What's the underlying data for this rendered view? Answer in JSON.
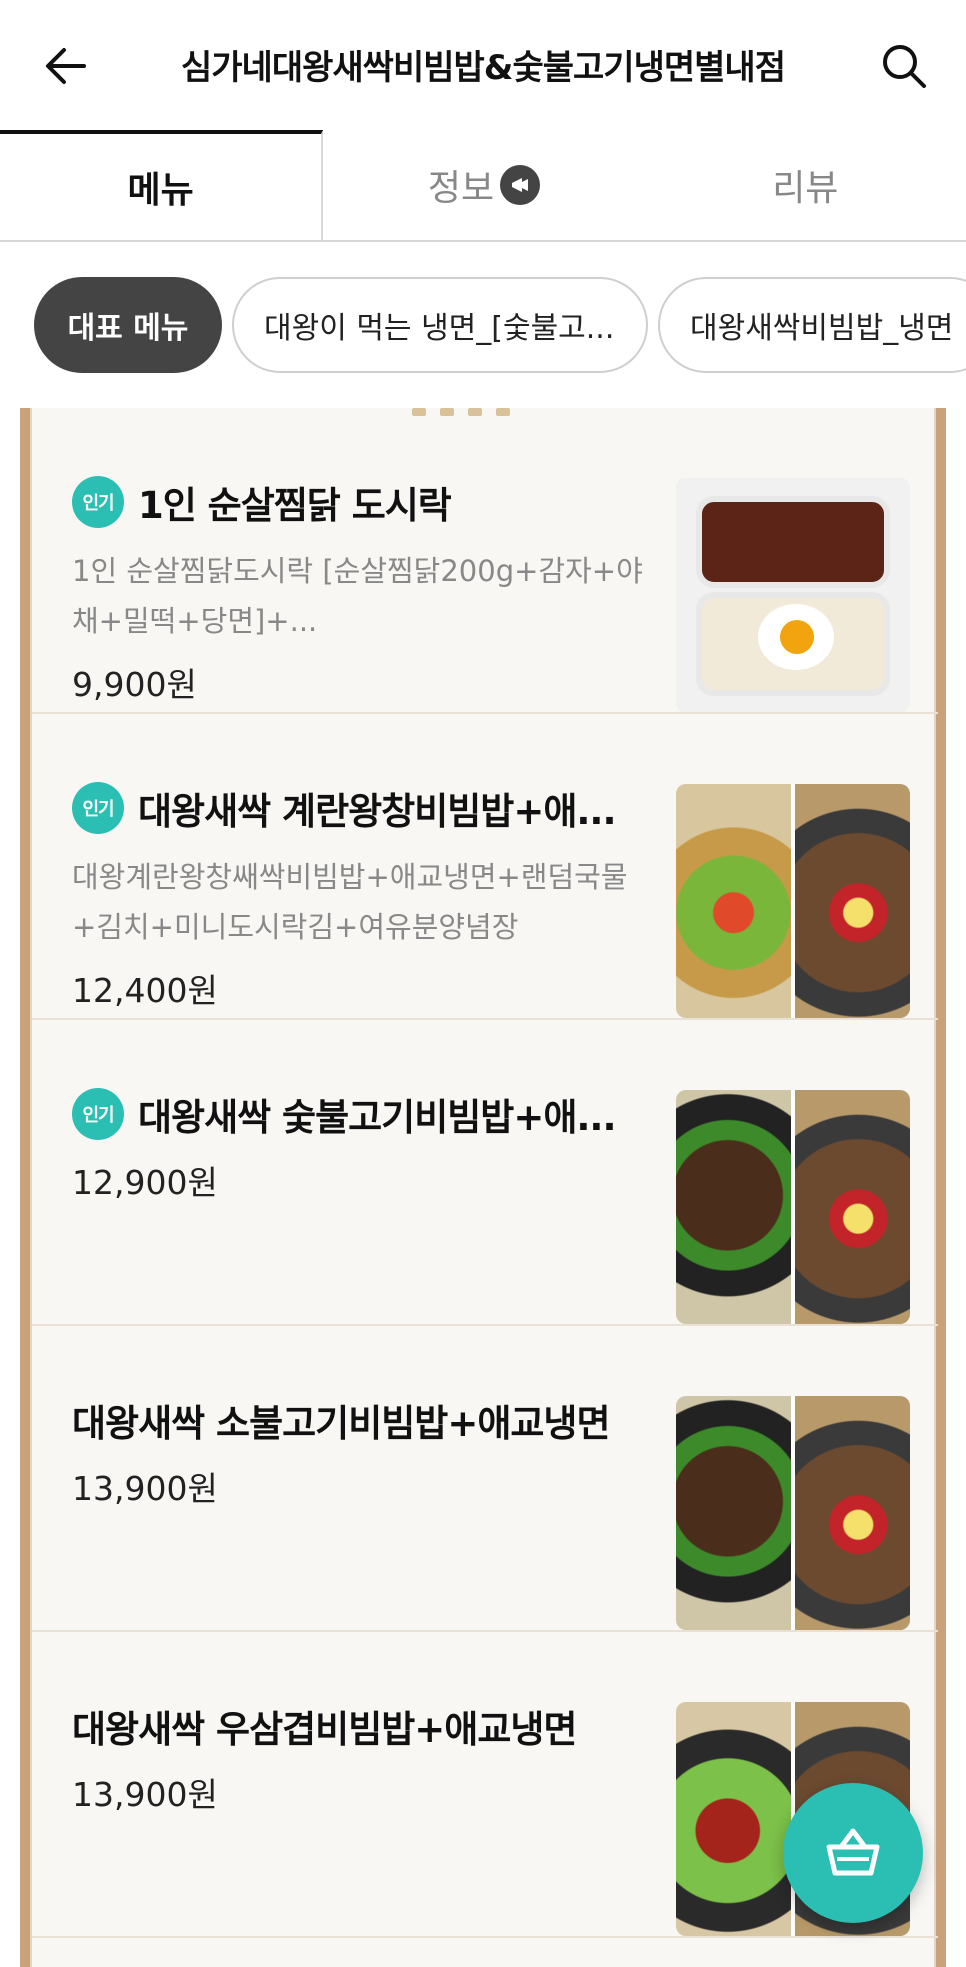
{
  "header": {
    "title": "심가네대왕새싹비빔밥&숯불고기냉면별내점"
  },
  "tabs": [
    {
      "label": "메뉴"
    },
    {
      "label": "정보"
    },
    {
      "label": "리뷰"
    }
  ],
  "chips": [
    {
      "label": "대표 메뉴"
    },
    {
      "label": "대왕이 먹는 냉면_[숯불고..."
    },
    {
      "label": "대왕새싹비빔밥_냉면"
    }
  ],
  "popular_badge": "인기",
  "menu": [
    {
      "name": "1인 순살찜닭 도시락",
      "desc": "1인 순살찜닭도시락 [순살찜닭200g+감자+야채+밀떡+당면]+...",
      "price": "9,900원",
      "popular": true
    },
    {
      "name": "대왕새싹 계란왕창비빔밥+애...",
      "desc": "대왕계란왕창쌔싹비빔밥+애교냉면+랜덤국물+김치+미니도시락김+여유분양념장",
      "price": "12,400원",
      "popular": true
    },
    {
      "name": "대왕새싹 숯불고기비빔밥+애...",
      "desc": "",
      "price": "12,900원",
      "popular": true
    },
    {
      "name": "대왕새싹 소불고기비빔밥+애교냉면",
      "desc": "",
      "price": "13,900원",
      "popular": false
    },
    {
      "name": "대왕새싹 우삼겹비빔밥+애교냉면",
      "desc": "",
      "price": "13,900원",
      "popular": false
    }
  ],
  "icons": {
    "back": "arrow-left-icon",
    "search": "search-icon",
    "info_badge": "megaphone-icon",
    "cart": "basket-icon"
  },
  "colors": {
    "accent": "#2bbfb3",
    "chip_active": "#444444",
    "frame": "#c9a27b"
  }
}
